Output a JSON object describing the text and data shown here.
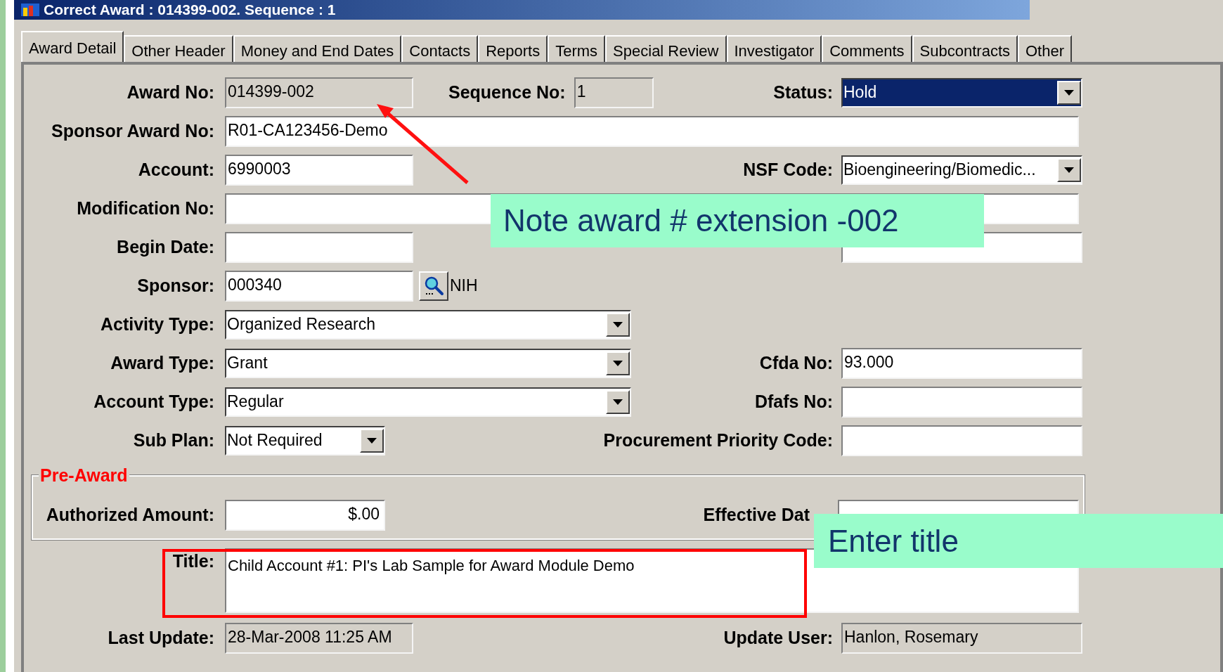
{
  "window": {
    "title": "Correct Award : 014399-002. Sequence : 1"
  },
  "tabs": [
    {
      "label": "Award Detail",
      "selected": true
    },
    {
      "label": "Other Header",
      "selected": false
    },
    {
      "label": "Money and End Dates",
      "selected": false
    },
    {
      "label": "Contacts",
      "selected": false
    },
    {
      "label": "Reports",
      "selected": false
    },
    {
      "label": "Terms",
      "selected": false
    },
    {
      "label": "Special Review",
      "selected": false
    },
    {
      "label": "Investigator",
      "selected": false
    },
    {
      "label": "Comments",
      "selected": false
    },
    {
      "label": "Subcontracts",
      "selected": false
    },
    {
      "label": "Other",
      "selected": false
    }
  ],
  "rows": [
    {
      "label": "Award No:",
      "field": {
        "kind": "readonly",
        "value": "014399-002"
      },
      "middle": {
        "label": "Sequence No:",
        "field": {
          "kind": "readonly",
          "value": "1"
        }
      },
      "right": {
        "label": "Status:",
        "field": {
          "kind": "dropdown",
          "value": "Hold",
          "highlighted": true
        }
      }
    },
    {
      "label": "Sponsor Award No:",
      "field": {
        "kind": "text",
        "value": "R01-CA123456-Demo"
      }
    },
    {
      "label": "Account:",
      "field": {
        "kind": "text",
        "value": "6990003"
      },
      "right": {
        "label": "NSF Code:",
        "field": {
          "kind": "dropdown",
          "value": "Bioengineering/Biomedic...",
          "highlighted": false
        }
      }
    },
    {
      "label": "Modification No:",
      "field": {
        "kind": "text"
      }
    },
    {
      "label": "Begin Date:",
      "field": {
        "kind": "text"
      },
      "right": {
        "field": {
          "kind": "text"
        }
      }
    },
    {
      "label": "Sponsor:",
      "field": {
        "kind": "text",
        "value": "000340"
      },
      "lookup": {
        "text": "NIH"
      }
    },
    {
      "label": "Activity Type:",
      "field": {
        "kind": "dropdown",
        "value": "Organized Research",
        "highlighted": false
      }
    },
    {
      "label": "Award Type:",
      "field": {
        "kind": "dropdown",
        "value": "Grant",
        "highlighted": false
      },
      "right": {
        "label": "Cfda No:",
        "field": {
          "kind": "text",
          "value": "93.000"
        }
      }
    },
    {
      "label": "Account Type:",
      "field": {
        "kind": "dropdown",
        "value": "Regular",
        "highlighted": false
      },
      "right": {
        "label": "Dfafs No:",
        "field": {
          "kind": "text"
        }
      }
    },
    {
      "label": "Sub Plan:",
      "field": {
        "kind": "dropdown",
        "value": "Not Required",
        "highlighted": false
      },
      "right": {
        "label": "Procurement Priority Code:",
        "field": {
          "kind": "text"
        }
      }
    }
  ],
  "pre_award": {
    "title": "Pre-Award",
    "row": {
      "label": "Authorized Amount:",
      "field": {
        "kind": "amount",
        "value": "$.00"
      },
      "right": {
        "label": "Effective Dat",
        "field": {
          "kind": "text"
        }
      }
    }
  },
  "title_row": {
    "label": "Title:",
    "field": {
      "kind": "textarea",
      "value": "Child Account #1: PI's Lab Sample for Award Module Demo"
    }
  },
  "footer_row": {
    "label": "Last Update:",
    "field": {
      "kind": "readonly",
      "value": "28-Mar-2008 11:25 AM"
    },
    "right": {
      "label": "Update User:",
      "field": {
        "kind": "readonly",
        "value": "Hanlon, Rosemary"
      }
    }
  },
  "annotations": [
    {
      "text": "Note award # extension -002"
    },
    {
      "text": "Enter title"
    }
  ]
}
